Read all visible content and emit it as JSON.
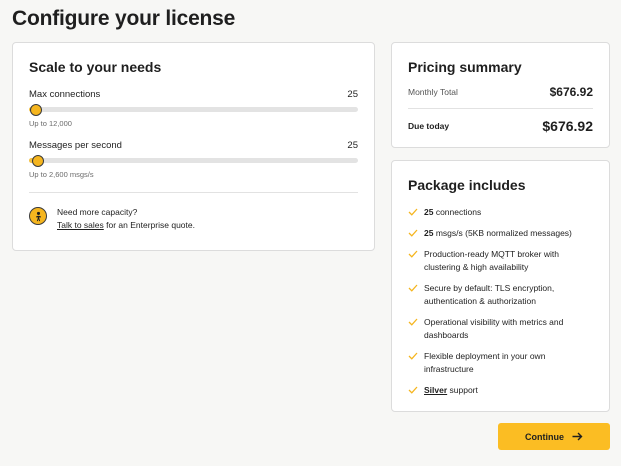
{
  "page": {
    "title": "Configure your license"
  },
  "scale": {
    "title": "Scale to your needs",
    "connections": {
      "label": "Max connections",
      "value": "25",
      "hint": "Up to 12,000",
      "fraction": 0.002
    },
    "messages": {
      "label": "Messages per second",
      "value": "25",
      "hint": "Up to 2,600 msgs/s",
      "fraction": 0.01
    },
    "capacity": {
      "icon": "people-icon",
      "heading": "Need more capacity?",
      "link_text": "Talk to sales",
      "suffix": " for an Enterprise quote."
    }
  },
  "pricing": {
    "title": "Pricing summary",
    "monthly_label": "Monthly Total",
    "monthly_value": "$676.92",
    "due_label": "Due today",
    "due_value": "$676.92"
  },
  "package": {
    "title": "Package includes",
    "features": [
      {
        "bold": "25",
        "text": " connections"
      },
      {
        "bold": "25",
        "text": " msgs/s (5KB normalized messages)"
      },
      {
        "bold": "",
        "text": "Production-ready MQTT broker with clustering & high availability"
      },
      {
        "bold": "",
        "text": "Secure by default: TLS encryption, authentication & authorization"
      },
      {
        "bold": "",
        "text": "Operational visibility with metrics and dashboards"
      },
      {
        "bold": "",
        "text": "Flexible deployment in your own infrastructure"
      },
      {
        "bold": "Silver",
        "text": " support",
        "underline": true
      }
    ]
  },
  "actions": {
    "continue_label": "Continue",
    "continue_icon": "arrow-right-icon"
  },
  "colors": {
    "accent": "#fbbd23",
    "check": "#f5b51e"
  }
}
